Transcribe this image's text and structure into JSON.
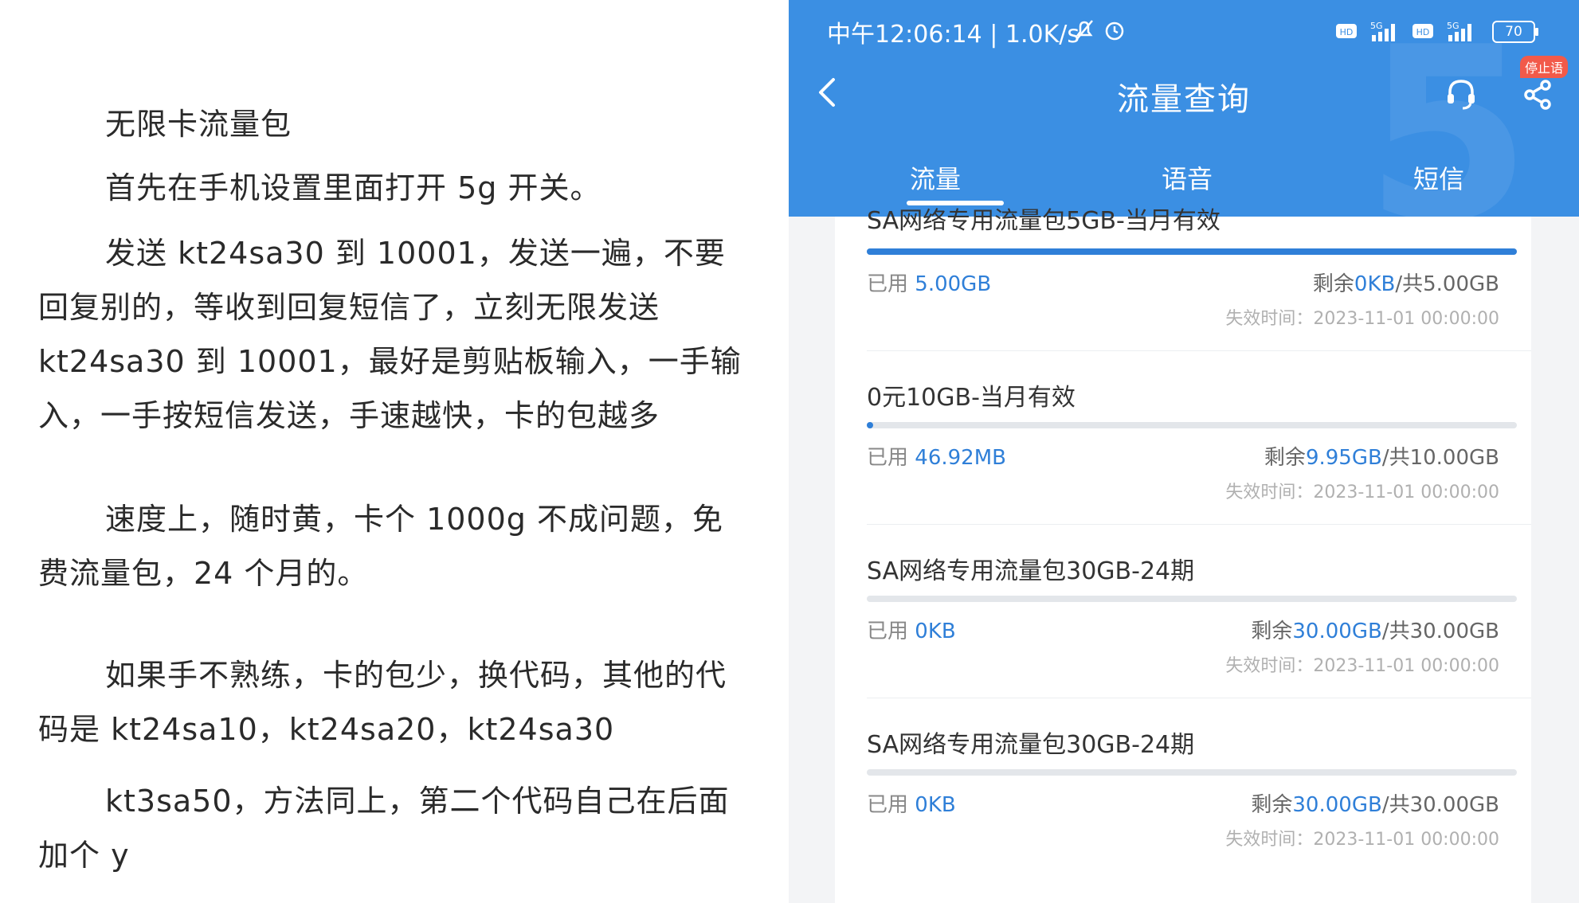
{
  "left_article": {
    "paragraphs": [
      "无限卡流量包",
      "首先在手机设置里面打开 5g 开关。",
      "发送 kt24sa30 到 10001，发送一遍，不要回复别的，等收到回复短信了，立刻无限发送kt24sa30 到 10001，最好是剪贴板输入，一手输入，一手按短信发送，手速越快，卡的包越多",
      "速度上，随时黄，卡个 1000g 不成问题，免费流量包，24 个月的。",
      "如果手不熟练，卡的包少，换代码，其他的代码是 kt24sa10，kt24sa20，kt24sa30",
      "kt3sa50，方法同上，第二个代码自己在后面加个 y"
    ]
  },
  "status_bar": {
    "time": "中午12:06:14 | 1.0K/s",
    "battery": "70",
    "signal_labels": [
      "HD",
      "5G",
      "HD",
      "5G"
    ]
  },
  "header": {
    "title": "流量查询",
    "stop_badge": "停止语"
  },
  "tabs": [
    {
      "label": "流量",
      "active": true
    },
    {
      "label": "语音",
      "active": false
    },
    {
      "label": "短信",
      "active": false
    }
  ],
  "packages": [
    {
      "name": "SA网络专用流量包5GB-当月有效",
      "used_label": "已用",
      "used": "5.00GB",
      "remain_prefix": "剩余",
      "remain": "0KB",
      "total": "/共5.00GB",
      "expire": "失效时间：2023-11-01 00:00:00",
      "usage_fraction": 1.0
    },
    {
      "name": "0元10GB-当月有效",
      "used_label": "已用",
      "used": "46.92MB",
      "remain_prefix": "剩余",
      "remain": "9.95GB",
      "total": "/共10.00GB",
      "expire": "失效时间：2023-11-01 00:00:00",
      "usage_fraction": 0.0046
    },
    {
      "name": "SA网络专用流量包30GB-24期",
      "used_label": "已用",
      "used": "0KB",
      "remain_prefix": "剩余",
      "remain": "30.00GB",
      "total": "/共30.00GB",
      "expire": "失效时间：2023-11-01 00:00:00",
      "usage_fraction": 0
    },
    {
      "name": "SA网络专用流量包30GB-24期",
      "used_label": "已用",
      "used": "0KB",
      "remain_prefix": "剩余",
      "remain": "30.00GB",
      "total": "/共30.00GB",
      "expire": "失效时间：2023-11-01 00:00:00",
      "usage_fraction": 0
    }
  ],
  "colors": {
    "header_blue": "#3b8fe3",
    "value_blue": "#2f7fd8"
  }
}
